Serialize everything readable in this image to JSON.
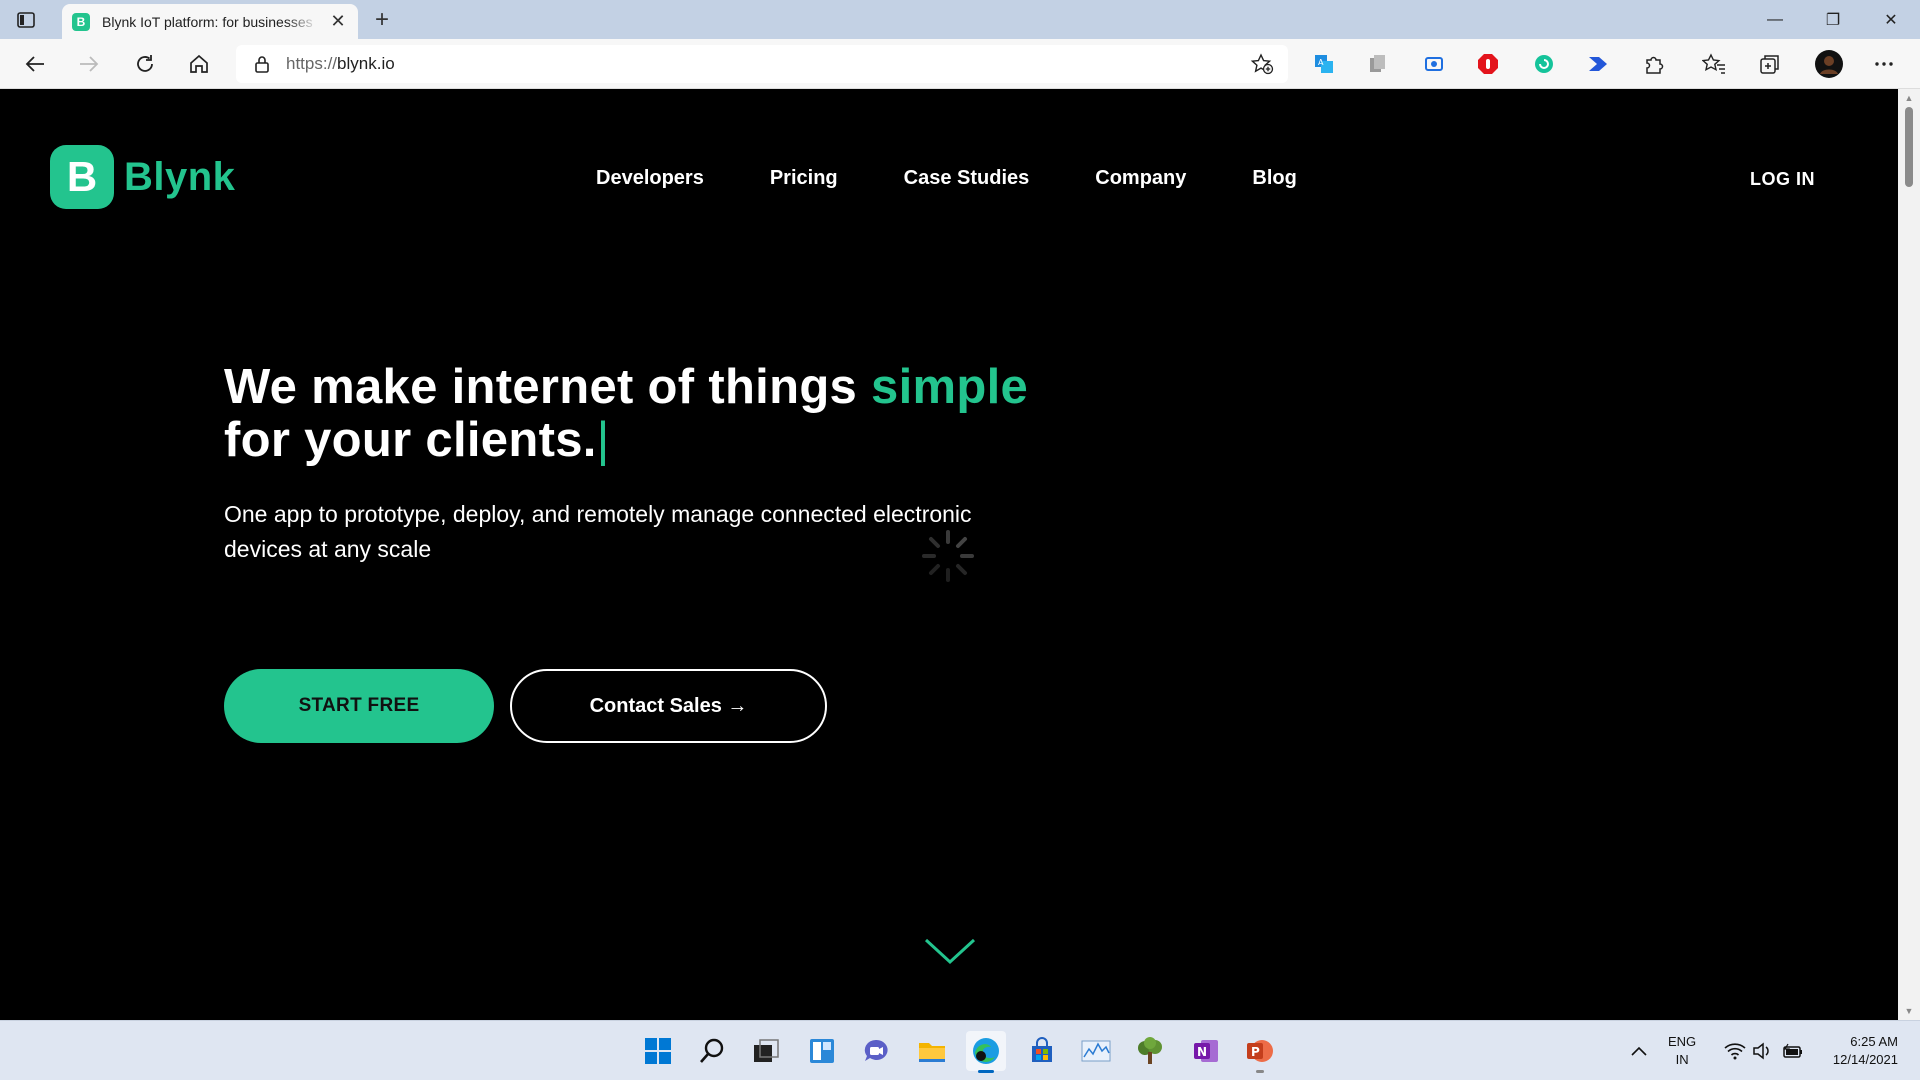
{
  "browser": {
    "tab": {
      "favicon_letter": "B",
      "title": "Blynk IoT platform: for businesses",
      "close": "✕"
    },
    "new_tab": "+",
    "address": {
      "scheme": "https://",
      "host": "blynk.io"
    },
    "window_controls": {
      "minimize": "—",
      "restore": "❐",
      "close": "✕"
    }
  },
  "site": {
    "logo": {
      "mark": "B",
      "wordmark": "Blynk"
    },
    "nav": [
      "Developers",
      "Pricing",
      "Case Studies",
      "Company",
      "Blog"
    ],
    "login": "LOG IN",
    "hero": {
      "headline_part1": "We make internet of things ",
      "headline_accent": "simple",
      "headline_part2": "for your clients.",
      "caret": "|",
      "subline": "One app to prototype, deploy, and remotely manage connected electronic devices at any scale"
    },
    "cta": {
      "primary": "START FREE",
      "secondary": "Contact Sales →"
    }
  },
  "colors": {
    "accent": "#23c48e",
    "page_bg": "#000000",
    "taskbar_bg": "#dfe6f2"
  },
  "taskbar": {
    "apps": [
      "start-icon",
      "search-icon",
      "task-view-icon",
      "widgets-icon",
      "teams-chat-icon",
      "file-explorer-icon",
      "edge-icon",
      "store-icon",
      "stock-chart-icon",
      "tree-app-icon",
      "onenote-icon",
      "powerpoint-icon"
    ],
    "language": {
      "line1": "ENG",
      "line2": "IN"
    },
    "time": "6:25 AM",
    "date": "12/14/2021"
  }
}
